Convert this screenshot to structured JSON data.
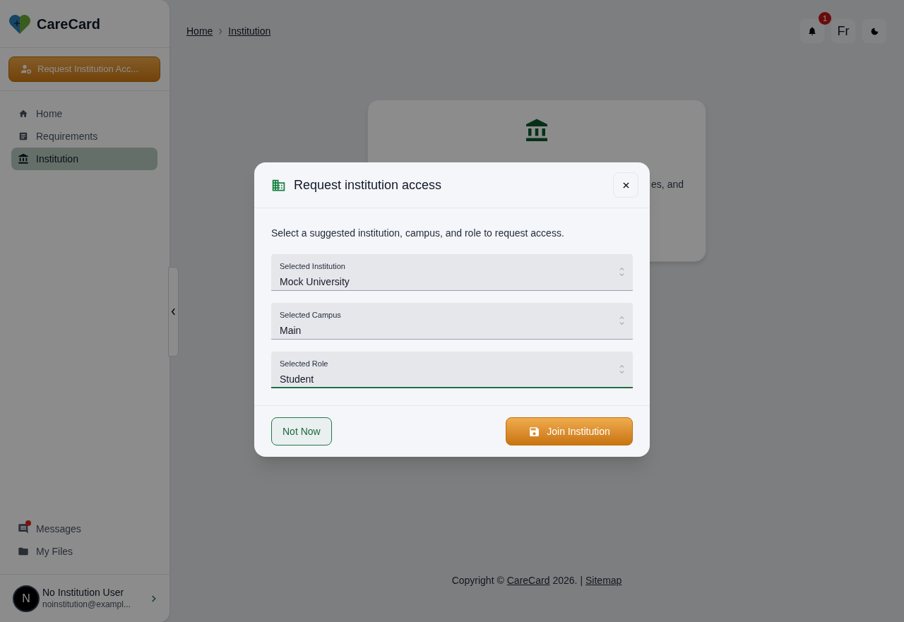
{
  "app": {
    "name": "CareCard"
  },
  "sidebar": {
    "request_button": "Request Institution Acc...",
    "nav_items": [
      {
        "kind": "home",
        "label": "Home",
        "selected": false,
        "badge": false
      },
      {
        "kind": "requirements",
        "label": "Requirements",
        "selected": false,
        "badge": false
      },
      {
        "kind": "institution",
        "label": "Institution",
        "selected": true,
        "badge": false
      }
    ],
    "bottom_items": [
      {
        "kind": "messages",
        "label": "Messages",
        "selected": false,
        "badge": true
      },
      {
        "kind": "files",
        "label": "My Files",
        "selected": false,
        "badge": false
      }
    ],
    "user": {
      "initial": "N",
      "name": "No Institution User",
      "email": "noinstitution@exampl..."
    }
  },
  "breadcrumbs": [
    "Home",
    "Institution"
  ],
  "header": {
    "notification_count": "1",
    "language": "Fr"
  },
  "card": {
    "text_fragment": "es, and"
  },
  "dialog": {
    "title": "Request institution access",
    "description": "Select a suggested institution, campus, and role to request access.",
    "fields": [
      {
        "label": "Selected Institution",
        "value": "Mock University",
        "focused": false
      },
      {
        "label": "Selected Campus",
        "value": "Main",
        "focused": false
      },
      {
        "label": "Selected Role",
        "value": "Student",
        "focused": true
      }
    ],
    "cancel_button": "Not Now",
    "submit_button": "Join Institution"
  },
  "footer": {
    "prefix": "Copyright ©",
    "brand_link": "CareCard",
    "middle": "2026. |",
    "sitemap_link": "Sitemap"
  }
}
